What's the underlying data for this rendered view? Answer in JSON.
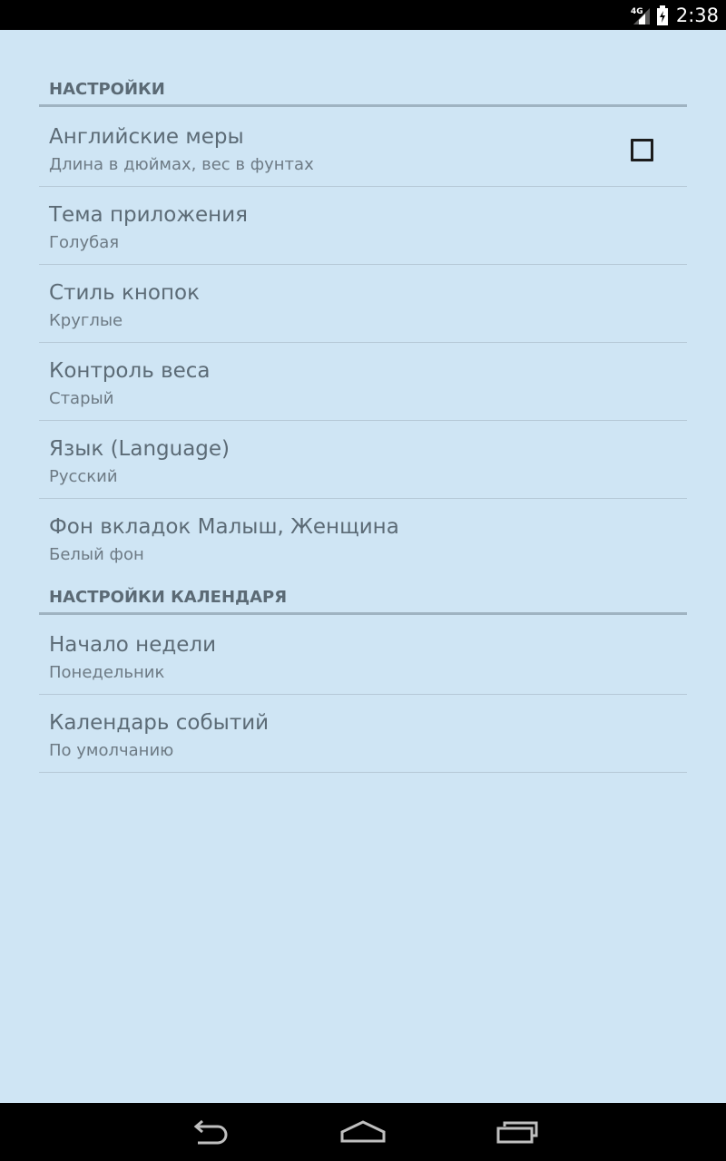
{
  "status_bar": {
    "network": "4G",
    "time": "2:38"
  },
  "sections": [
    {
      "title": "НАСТРОЙКИ",
      "items": [
        {
          "title": "Английские меры",
          "summary": "Длина в дюймах, вес в фунтах",
          "checkbox": true,
          "checked": false
        },
        {
          "title": "Тема приложения",
          "summary": "Голубая"
        },
        {
          "title": "Стиль кнопок",
          "summary": "Круглые"
        },
        {
          "title": "Контроль веса",
          "summary": "Старый"
        },
        {
          "title": "Язык (Language)",
          "summary": "Русский"
        },
        {
          "title": "Фон вкладок Малыш, Женщина",
          "summary": "Белый фон"
        }
      ]
    },
    {
      "title": "НАСТРОЙКИ КАЛЕНДАРЯ",
      "items": [
        {
          "title": "Начало недели",
          "summary": "Понедельник"
        },
        {
          "title": "Календарь событий",
          "summary": "По умолчанию"
        }
      ]
    }
  ],
  "nav_bar": {
    "back_icon": "back-icon",
    "home_icon": "home-icon",
    "recents_icon": "recents-icon"
  },
  "colors": {
    "background": "#cfe5f4",
    "title_text": "#5c6b76",
    "summary_text": "#6d7a84",
    "section_divider": "#9fb3c1"
  }
}
